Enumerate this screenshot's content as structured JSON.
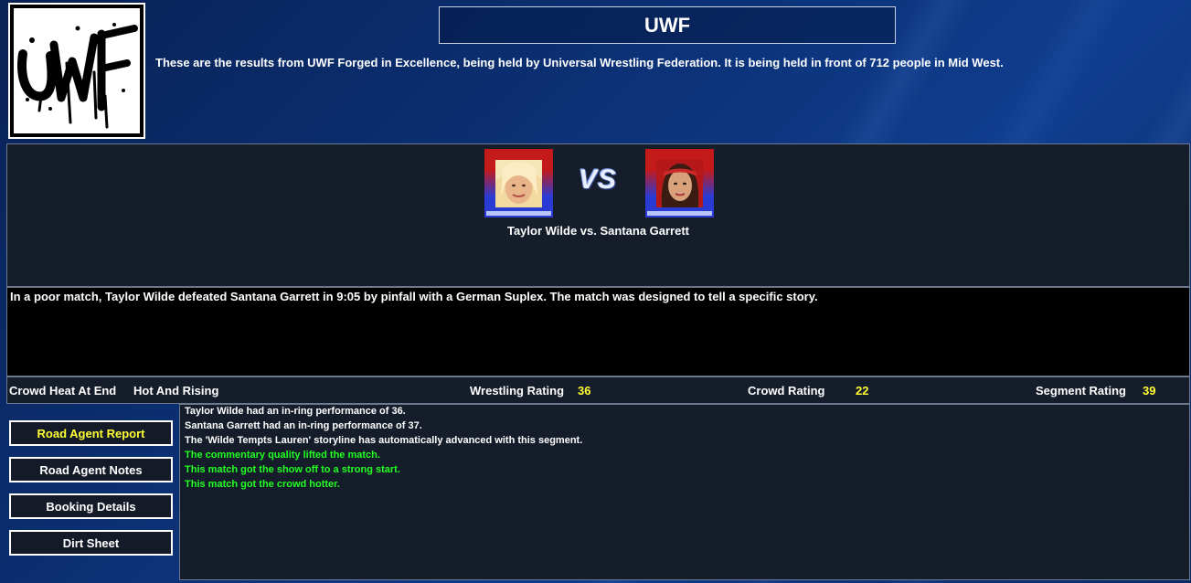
{
  "header": {
    "title": "UWF",
    "intro": "These are the results from UWF Forged in Excellence, being held by Universal Wrestling Federation. It is being held in front of 712 people in Mid West."
  },
  "match": {
    "vs_label": "VS",
    "name": "Taylor Wilde vs. Santana Garrett",
    "wrestler1": "Taylor Wilde",
    "wrestler2": "Santana Garrett",
    "result": "In a poor match, Taylor Wilde defeated Santana Garrett in 9:05 by pinfall with a German Suplex. The match was designed to tell a specific story."
  },
  "stats": {
    "crowd_heat_label": "Crowd Heat At End",
    "crowd_heat_value": "Hot And Rising",
    "wrestling_rating_label": "Wrestling Rating",
    "wrestling_rating_value": "36",
    "crowd_rating_label": "Crowd Rating",
    "crowd_rating_value": "22",
    "segment_rating_label": "Segment Rating",
    "segment_rating_value": "39"
  },
  "buttons": [
    {
      "label": "Road Agent Report",
      "active": true
    },
    {
      "label": "Road Agent Notes",
      "active": false
    },
    {
      "label": "Booking Details",
      "active": false
    },
    {
      "label": "Dirt Sheet",
      "active": false
    }
  ],
  "log": [
    {
      "text": "Taylor Wilde had an in-ring performance of 36.",
      "color": "#ffffff"
    },
    {
      "text": "Santana Garrett had an in-ring performance of 37.",
      "color": "#ffffff"
    },
    {
      "text": "The 'Wilde Tempts Lauren' storyline has automatically advanced with this segment.",
      "color": "#ffffff"
    },
    {
      "text": "The commentary quality lifted the match.",
      "color": "#22ff22"
    },
    {
      "text": "This match got the show off to a strong start.",
      "color": "#22ff22"
    },
    {
      "text": "This match got the crowd hotter.",
      "color": "#22ff22"
    }
  ],
  "icons": {
    "logo": "uwf-logo",
    "wrestler1_portrait": "wrestler-portrait",
    "wrestler2_portrait": "wrestler-portrait"
  }
}
